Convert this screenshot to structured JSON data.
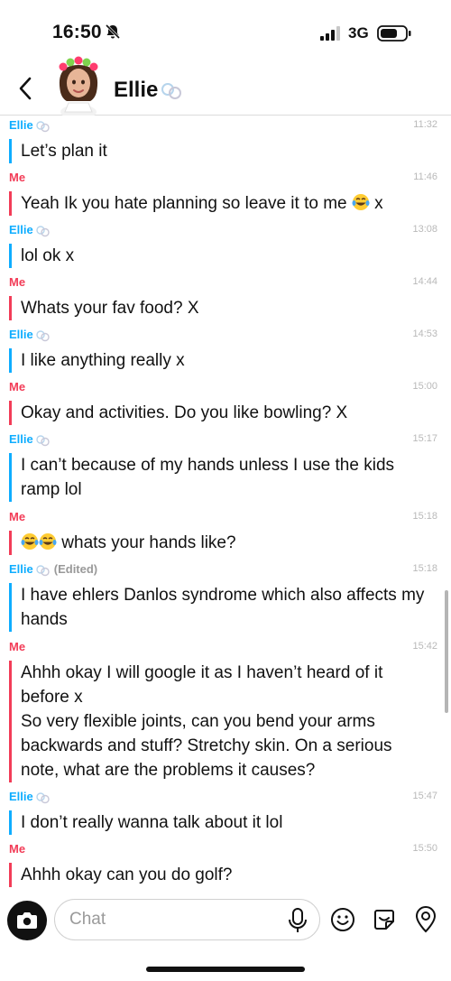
{
  "status": {
    "time": "16:50",
    "network": "3G"
  },
  "header": {
    "name": "Ellie"
  },
  "messages": [
    {
      "sender": "Ellie",
      "time": "11:32",
      "text": "Let’s plan it"
    },
    {
      "sender": "Me",
      "time": "11:46",
      "text": "Yeah Ik you hate planning so leave it to me",
      "emoji_after": "laughing-tears",
      "suffix": " x"
    },
    {
      "sender": "Ellie",
      "time": "13:08",
      "text": "lol ok x"
    },
    {
      "sender": "Me",
      "time": "14:44",
      "text": "Whats your fav food? X"
    },
    {
      "sender": "Ellie",
      "time": "14:53",
      "text": "I like anything really x"
    },
    {
      "sender": "Me",
      "time": "15:00",
      "text": "Okay and activities. Do you like bowling? X"
    },
    {
      "sender": "Ellie",
      "time": "15:17",
      "text": "I can’t because of my hands unless I use the kids ramp lol"
    },
    {
      "sender": "Me",
      "time": "15:18",
      "emoji_before": "laughing-tears x2",
      "text": " whats your hands like?"
    },
    {
      "sender": "Ellie",
      "edited": "(Edited)",
      "time": "15:18",
      "text": "I have ehlers Danlos syndrome which also affects my hands"
    },
    {
      "sender": "Me",
      "time": "15:42",
      "text": "Ahhh okay I will google it as I haven’t heard of it before x",
      "text2": "So very flexible joints, can you bend your arms backwards and stuff? Stretchy skin. On a serious note, what are the problems it causes?"
    },
    {
      "sender": "Ellie",
      "time": "15:47",
      "text": "I don’t really wanna talk about it lol"
    },
    {
      "sender": "Me",
      "time": "15:50",
      "text": "Ahhh okay can you do golf?"
    }
  ],
  "input": {
    "placeholder": "Chat"
  },
  "icons": {
    "back": "chevron-left-icon",
    "camera": "camera-icon",
    "mic": "microphone-icon",
    "bitmoji": "smiley-icon",
    "sticker": "sticker-icon",
    "location": "location-pin-icon",
    "friend_emoji": "bff-rings-icon"
  },
  "colors": {
    "ellie": "#0eadff",
    "me": "#f23c57"
  }
}
